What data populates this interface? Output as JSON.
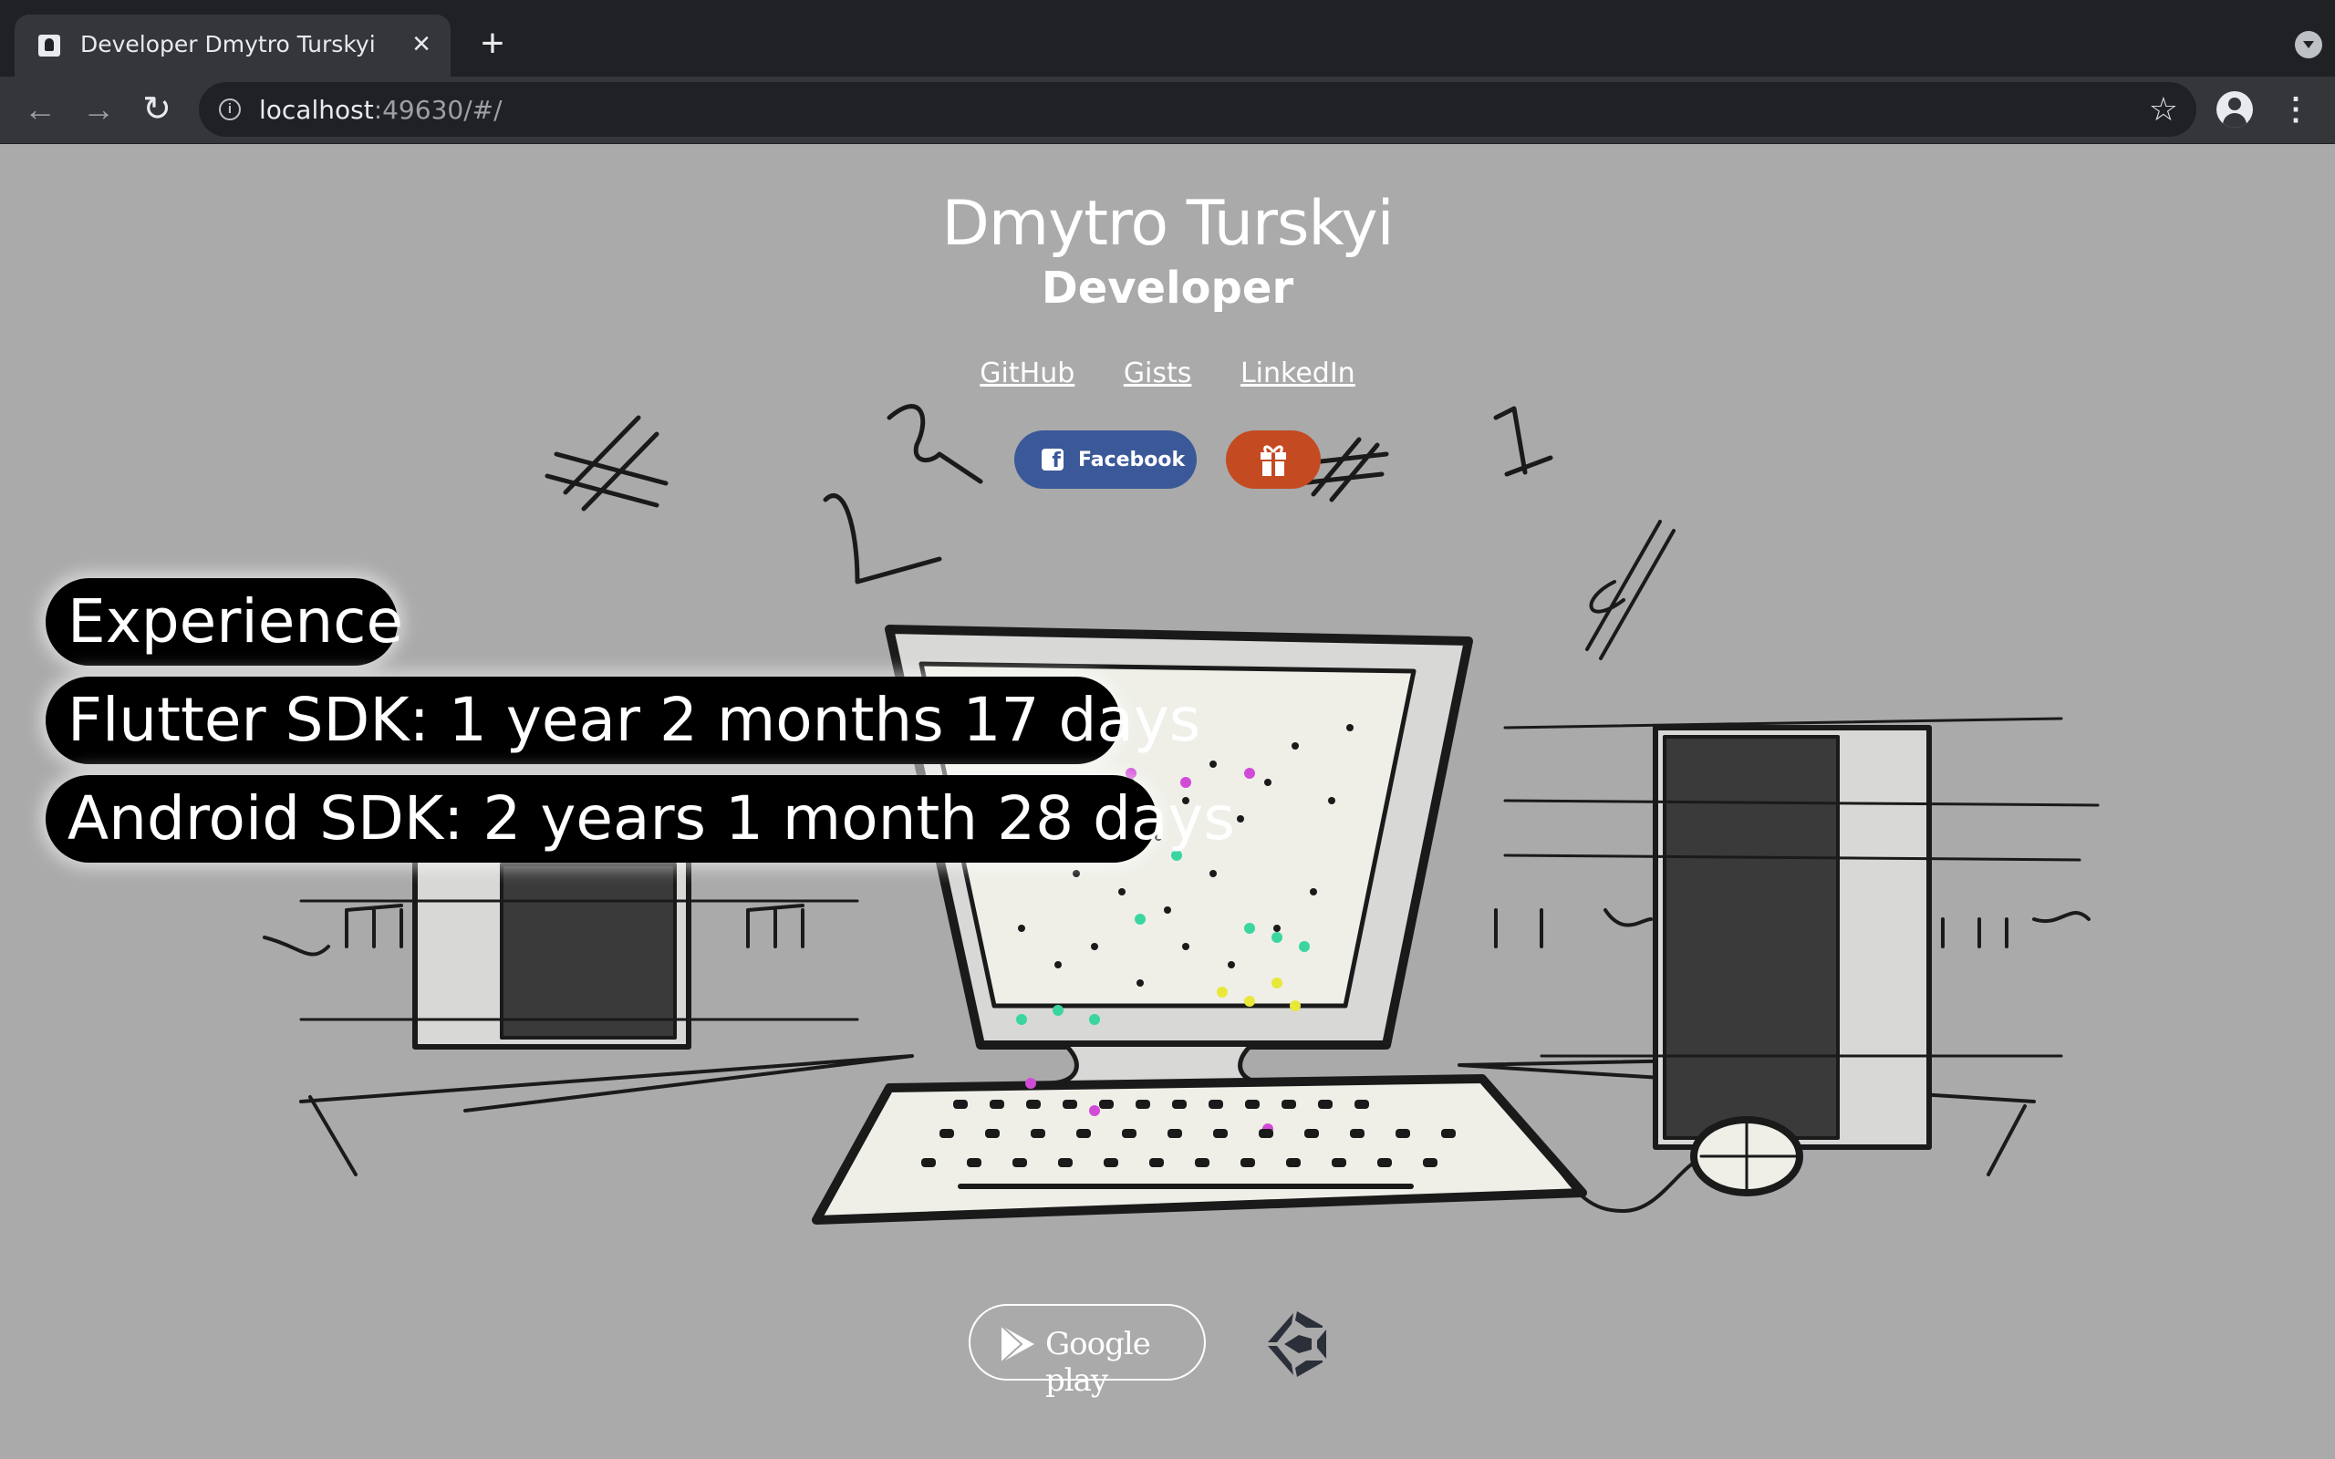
{
  "browser": {
    "tab_title": "Developer Dmytro Turskyi",
    "url_host": "localhost",
    "url_rest": ":49630/#/"
  },
  "header": {
    "name": "Dmytro Turskyi",
    "role": "Developer"
  },
  "links": [
    {
      "label": "GitHub"
    },
    {
      "label": "Gists"
    },
    {
      "label": "LinkedIn"
    }
  ],
  "buttons": {
    "facebook_label": "Facebook"
  },
  "experience": {
    "title": "Experience",
    "items": [
      "Flutter SDK: 1 year 2 months 17 days",
      "Android SDK: 2 years 1 month 28 days"
    ]
  },
  "store": {
    "google_play_label": "Google play"
  },
  "icons": {
    "favicon": "portrait-icon",
    "facebook": "facebook-icon",
    "gift": "gift-icon",
    "google_play": "google-play-icon",
    "unity": "unity-icon"
  },
  "colors": {
    "page_background": "#a9aaa9",
    "facebook": "#3b5998",
    "gift": "#c44a22",
    "pill": "#000000"
  }
}
